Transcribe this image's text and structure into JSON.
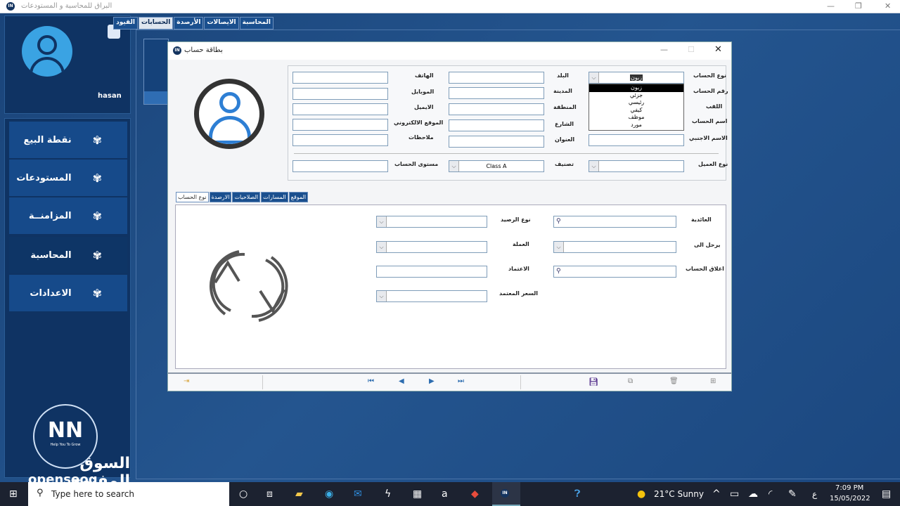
{
  "app": {
    "title": "البراق للمحاسبة و المستودعات",
    "logo": "IN"
  },
  "profile": {
    "username": "hasan",
    "avatar_icon": "user-icon",
    "settings_icon": "puzzle-gear-icon"
  },
  "sidebar": {
    "items": [
      {
        "label": "نقطة البيع"
      },
      {
        "label": "المستودعات"
      },
      {
        "label": "المزامنــة"
      },
      {
        "label": "المحاسبة",
        "selected": true
      },
      {
        "label": "الاعدادات"
      }
    ],
    "icon": "fan-icon"
  },
  "top_tabs": [
    {
      "label": "المحاسبة"
    },
    {
      "label": "الايصالات"
    },
    {
      "label": "الأرصدة"
    },
    {
      "label": "الحسابات",
      "selected": true
    },
    {
      "label": "القيود"
    }
  ],
  "dialog": {
    "title": "بطاقة حساب",
    "fields_col1": [
      {
        "label": "نوع الحساب",
        "value": "زبون"
      },
      {
        "label": "رقم الحساب",
        "value": ""
      },
      {
        "label": "اللقب",
        "value": ""
      },
      {
        "label": "اسم الحساب",
        "value": ""
      },
      {
        "label": "الاسم الاجنبي",
        "value": ""
      }
    ],
    "fields_col2": [
      {
        "label": "البلد"
      },
      {
        "label": "المدينة"
      },
      {
        "label": "المنطقة"
      },
      {
        "label": "الشارع"
      },
      {
        "label": "العنوان"
      }
    ],
    "fields_col3": [
      {
        "label": "الهاتف"
      },
      {
        "label": "الموبايل"
      },
      {
        "label": "الايميل"
      },
      {
        "label": "الموقع الالكتروني"
      },
      {
        "label": "ملاحظات"
      }
    ],
    "customer_type": {
      "label": "نوع العميل",
      "value": ""
    },
    "classification": {
      "label": "تصنيف",
      "value": "Class A"
    },
    "account_level": {
      "label": "مستوى الحساب",
      "value": ""
    },
    "account_type_options": [
      "زبون",
      "جزئي",
      "رئيسي",
      "كيفي",
      "موظف",
      "مورد"
    ],
    "account_type_highlighted": "زبون",
    "bottom_tabs": [
      {
        "label": "نوع الحساب",
        "selected": true
      },
      {
        "label": "الارصدة"
      },
      {
        "label": "الصلاحيات"
      },
      {
        "label": "المسارات"
      },
      {
        "label": "الموقع"
      }
    ],
    "tab_fields_right": [
      {
        "label": "العائدية",
        "kind": "search"
      },
      {
        "label": "يرحل الى",
        "kind": "dropdown"
      },
      {
        "label": "اغلاق الحساب",
        "kind": "search"
      }
    ],
    "tab_fields_left": [
      {
        "label": "نوع الرصيد",
        "kind": "dropdown"
      },
      {
        "label": "العملة",
        "kind": "dropdown"
      },
      {
        "label": "الاعتماد",
        "kind": "text"
      },
      {
        "label": "السعر المعتمد",
        "kind": "dropdown"
      }
    ]
  },
  "watermark": {
    "brand_ar": "السوق المفتوح",
    "brand_en": "opensooq",
    "tagline": "Help You To Grow"
  },
  "taskbar": {
    "search_placeholder": "Type here to search",
    "weather": "21°C  Sunny",
    "time": "7:09 PM",
    "date": "15/05/2022",
    "lang": "ع"
  }
}
